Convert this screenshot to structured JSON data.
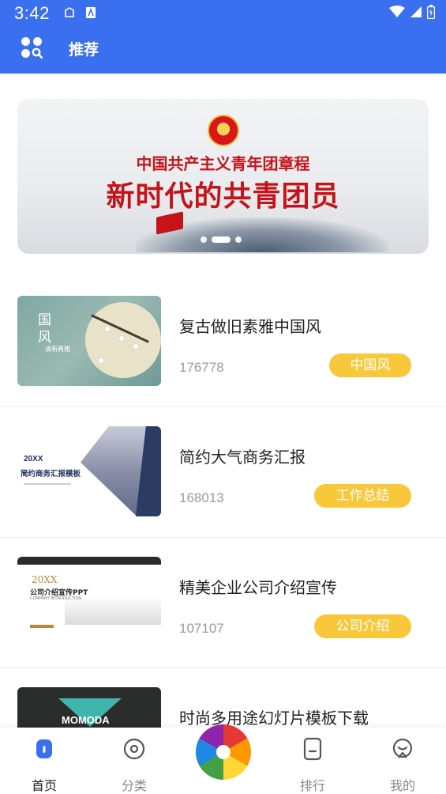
{
  "status": {
    "time": "3:42"
  },
  "appbar": {
    "title": "推荐",
    "icon": "category-search-icon"
  },
  "banner": {
    "line1": "中国共产主义青年团章程",
    "line2": "新时代的共青团员",
    "slides": 3,
    "active_slide": 2
  },
  "items": [
    {
      "title": "复古做旧素雅中国风",
      "count": "176778",
      "tag": "中国风",
      "thumb_text_1": "国\n风",
      "thumb_text_2": "清新典雅"
    },
    {
      "title": "简约大气商务汇报",
      "count": "168013",
      "tag": "工作总结",
      "thumb_text_1": "20XX",
      "thumb_text_2": "简约商务汇报模板"
    },
    {
      "title": "精美企业公司介绍宣传",
      "count": "107107",
      "tag": "公司介绍",
      "thumb_text_1": "20XX",
      "thumb_text_2": "公司介绍宣传PPT",
      "thumb_text_3": "COMPANY INTRODUCTION"
    },
    {
      "title": "时尚多用途幻灯片模板下载",
      "thumb_text_1": "MOMODA"
    }
  ],
  "nav": [
    {
      "label": "首页",
      "icon": "home-icon",
      "active": true
    },
    {
      "label": "分类",
      "icon": "category-icon",
      "active": false
    },
    {
      "label": "",
      "icon": "pinwheel-logo-icon",
      "active": false
    },
    {
      "label": "排行",
      "icon": "ranking-icon",
      "active": false
    },
    {
      "label": "我的",
      "icon": "profile-icon",
      "active": false
    }
  ],
  "colors": {
    "primary": "#3a6ff0",
    "tag": "#f8c83a",
    "title_red": "#c4141a"
  }
}
